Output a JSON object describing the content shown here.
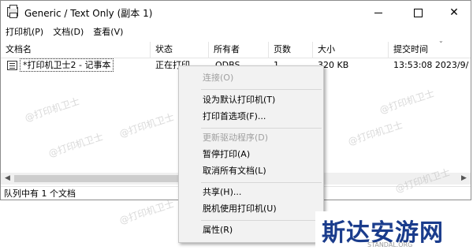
{
  "window": {
    "title": "Generic / Text Only (副本 1)",
    "controls": {
      "minimize": "minimize",
      "maximize": "maximize",
      "close": "✕"
    }
  },
  "menubar": [
    "打印机(P)",
    "文档(D)",
    "查看(V)"
  ],
  "columns": [
    "文档名",
    "状态",
    "所有者",
    "页数",
    "大小",
    "提交时间"
  ],
  "row": {
    "document": "*打印机卫士2 - 记事本",
    "status": "正在打印",
    "owner": "ODBS",
    "pages": "1",
    "size": "320 KB",
    "time": "13:53:08 2023/9/"
  },
  "statusbar": "队列中有 1 个文档",
  "context_menu": {
    "items": [
      {
        "label": "连接(O)",
        "disabled": true
      },
      {
        "label": "设为默认打印机(T)",
        "disabled": false
      },
      {
        "label": "打印首选项(F)...",
        "disabled": false
      },
      {
        "label": "更新驱动程序(D)",
        "disabled": true
      },
      {
        "label": "暂停打印(A)",
        "disabled": false
      },
      {
        "label": "取消所有文档(L)",
        "disabled": false
      },
      {
        "label": "共享(H)...",
        "disabled": false
      },
      {
        "label": "脱机使用打印机(U)",
        "disabled": false
      },
      {
        "label": "属性(R)",
        "disabled": false
      }
    ]
  },
  "watermark": "@打印机卫士",
  "logo": {
    "main": "斯达安游网",
    "sub": "STANDAL.ORG"
  }
}
